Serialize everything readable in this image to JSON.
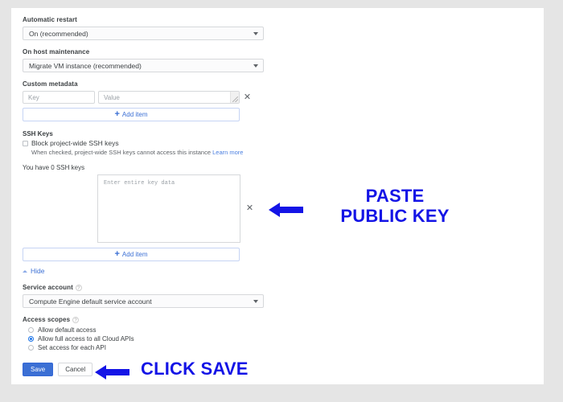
{
  "form": {
    "automatic_restart": {
      "label": "Automatic restart",
      "value": "On (recommended)"
    },
    "on_host_maintenance": {
      "label": "On host maintenance",
      "value": "Migrate VM instance (recommended)"
    },
    "custom_metadata": {
      "label": "Custom metadata",
      "key_placeholder": "Key",
      "value_placeholder": "Value",
      "remove_label": "✕",
      "add_item_label": "Add item",
      "plus": "+"
    },
    "ssh_keys": {
      "section_title": "SSH Keys",
      "block_checkbox_label": "Block project-wide SSH keys",
      "helper_text": "When checked, project-wide SSH keys cannot access this instance",
      "learn_more": "Learn more",
      "keys_count_text": "You have 0 SSH keys",
      "key_placeholder": "Enter entire key data",
      "remove_label": "✕",
      "add_item_label": "Add item",
      "plus": "+",
      "hide_label": "Hide"
    },
    "service_account": {
      "label": "Service account",
      "value": "Compute Engine default service account",
      "help_glyph": "?"
    },
    "access_scopes": {
      "label": "Access scopes",
      "help_glyph": "?",
      "options": [
        {
          "label": "Allow default access",
          "selected": false
        },
        {
          "label": "Allow full access to all Cloud APIs",
          "selected": true
        },
        {
          "label": "Set access for each API",
          "selected": false
        }
      ]
    },
    "actions": {
      "save_label": "Save",
      "cancel_label": "Cancel"
    }
  },
  "annotations": {
    "paste_key": {
      "line1": "PASTE",
      "line2": "PUBLIC KEY"
    },
    "click_save": {
      "line1": "CLICK SAVE"
    }
  },
  "colors": {
    "annotation_blue": "#1414E6",
    "primary_blue": "#3B6FD4",
    "link_blue": "#4A7FE0",
    "page_background": "#E5E5E5",
    "card_background": "#FFFFFF"
  }
}
